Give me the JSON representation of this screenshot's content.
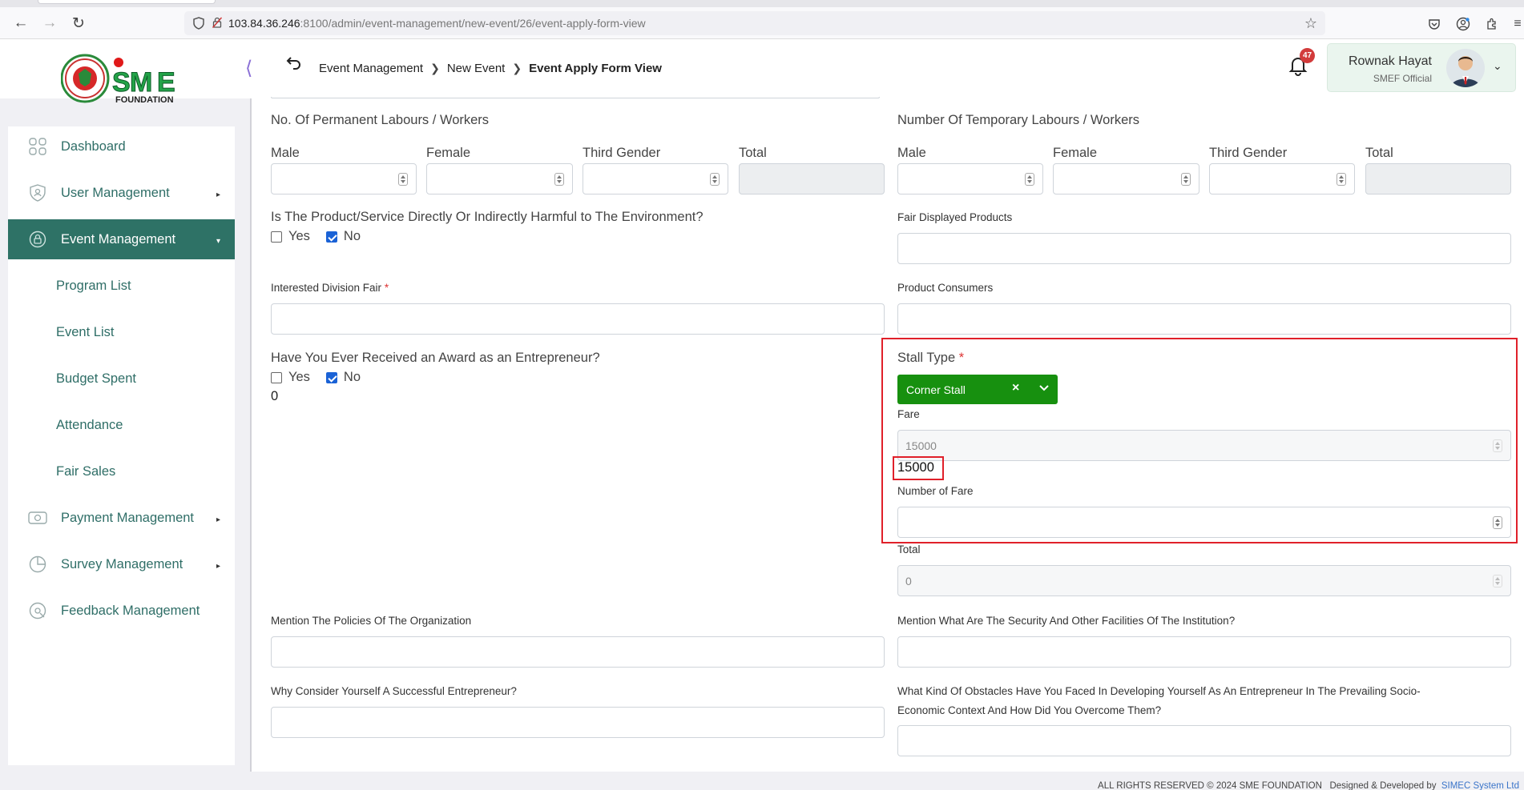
{
  "browser": {
    "url_host": "103.84.36.246",
    "url_rest": ":8100/admin/event-management/new-event/26/event-apply-form-view"
  },
  "logo": {
    "brand": "SME",
    "sub": "FOUNDATION"
  },
  "breadcrumb": {
    "items": [
      "Event Management",
      "New Event"
    ],
    "current": "Event Apply Form View"
  },
  "notifications": {
    "count": "47"
  },
  "user": {
    "name": "Rownak Hayat",
    "role": "SMEF Official"
  },
  "sidebar": {
    "dashboard": "Dashboard",
    "user_management": "User Management",
    "event_management": "Event Management",
    "sub": {
      "program_list": "Program List",
      "event_list": "Event List",
      "budget_spent": "Budget Spent",
      "attendance": "Attendance",
      "fair_sales": "Fair Sales"
    },
    "payment_management": "Payment Management",
    "survey_management": "Survey Management",
    "feedback_management": "Feedback Management"
  },
  "form": {
    "permanent": {
      "title": "No. Of Permanent Labours / Workers",
      "male": "Male",
      "female": "Female",
      "third_gender": "Third Gender",
      "total": "Total"
    },
    "temporary": {
      "title": "Number Of Temporary Labours / Workers",
      "male": "Male",
      "female": "Female",
      "third_gender": "Third Gender",
      "total": "Total"
    },
    "harmful": {
      "label": "Is The Product/Service Directly Or Indirectly Harmful to The Environment?",
      "yes": "Yes",
      "no": "No"
    },
    "fair_displayed": {
      "label": "Fair Displayed Products"
    },
    "interested_division": {
      "label": "Interested Division Fair",
      "req": "*"
    },
    "product_consumers": {
      "label": "Product Consumers"
    },
    "award": {
      "label": "Have You Ever Received an Award as an Entrepreneur?",
      "yes": "Yes",
      "no": "No",
      "value": "0"
    },
    "stall_type": {
      "label": "Stall Type",
      "req": "*",
      "selected": "Corner Stall",
      "clear": "×"
    },
    "fare": {
      "label": "Fare",
      "input_value": "15000",
      "display_value": "15000"
    },
    "number_of_fare": {
      "label": "Number of Fare"
    },
    "total": {
      "label": "Total",
      "value": "0"
    },
    "policies": {
      "label": "Mention The Policies Of The Organization"
    },
    "security": {
      "label": "Mention What Are The Security And Other Facilities Of The Institution?"
    },
    "successful": {
      "label": "Why Consider Yourself A Successful Entrepreneur?"
    },
    "obstacles": {
      "label_line1": "What Kind Of Obstacles Have You Faced In Developing Yourself As An Entrepreneur In The Prevailing Socio-",
      "label_line2": "Economic Context And How Did You Overcome Them?"
    }
  },
  "footer": {
    "copyright": "ALL RIGHTS RESERVED © 2024 SME FOUNDATION",
    "designed_by": "Designed & Developed by",
    "developer": "SIMEC System Ltd"
  }
}
